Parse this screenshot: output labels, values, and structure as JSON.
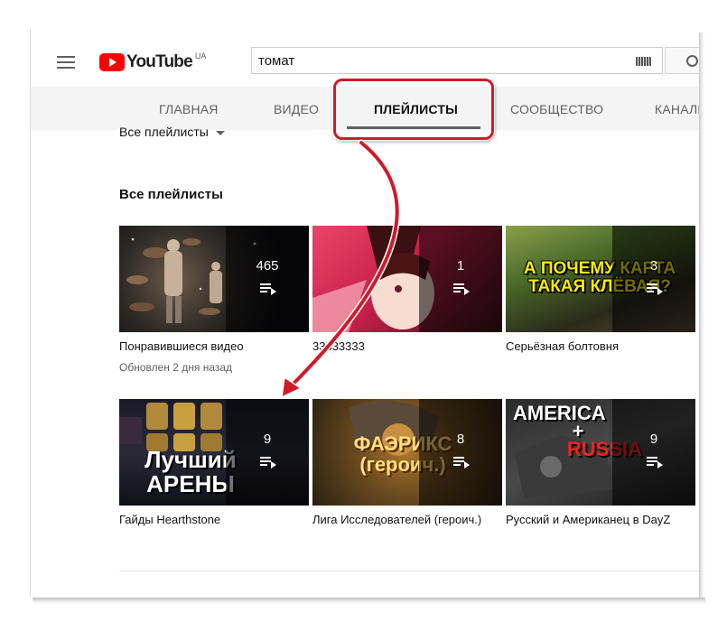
{
  "header": {
    "logo_text": "YouTube",
    "logo_region": "UA",
    "search_value": "томат"
  },
  "tabs": [
    {
      "label": "ГЛАВНАЯ",
      "active": false
    },
    {
      "label": "ВИДЕО",
      "active": false
    },
    {
      "label": "ПЛЕЙЛИСТЫ",
      "active": true
    },
    {
      "label": "СООБЩЕСТВО",
      "active": false
    },
    {
      "label": "КАНАЛЫ",
      "active": false
    }
  ],
  "filter": {
    "label": "Все плейлисты"
  },
  "section": {
    "title": "Все плейлисты"
  },
  "playlists": [
    {
      "title": "Понравившиеся видео",
      "count": "465",
      "meta": "Обновлен 2 дня назад"
    },
    {
      "title": "33333333",
      "count": "1"
    },
    {
      "title": "Серьёзная болтовня",
      "count": "3",
      "thumb_text": "А ПОЧЕМУ КАРТА ТАКАЯ КЛЁВАЯ?"
    },
    {
      "title": "Гайды Hearthstone",
      "count": "9",
      "thumb_text": "Лучший АРЕНЫ"
    },
    {
      "title": "Лига Исследователей (героич.)",
      "count": "8",
      "thumb_text": "ФАЭРИКС (героич.)"
    },
    {
      "title": "Русский и Американец в DayZ",
      "count": "9",
      "thumb_text_1": "AMERICA",
      "thumb_text_2": "+",
      "thumb_text_3": "RUSSIA"
    }
  ],
  "colors": {
    "accent_red": "#d01a28",
    "youtube_red": "#ff0000",
    "tab_bar": "#f4f4f4",
    "text": "#111111",
    "secondary_text": "#606060"
  }
}
